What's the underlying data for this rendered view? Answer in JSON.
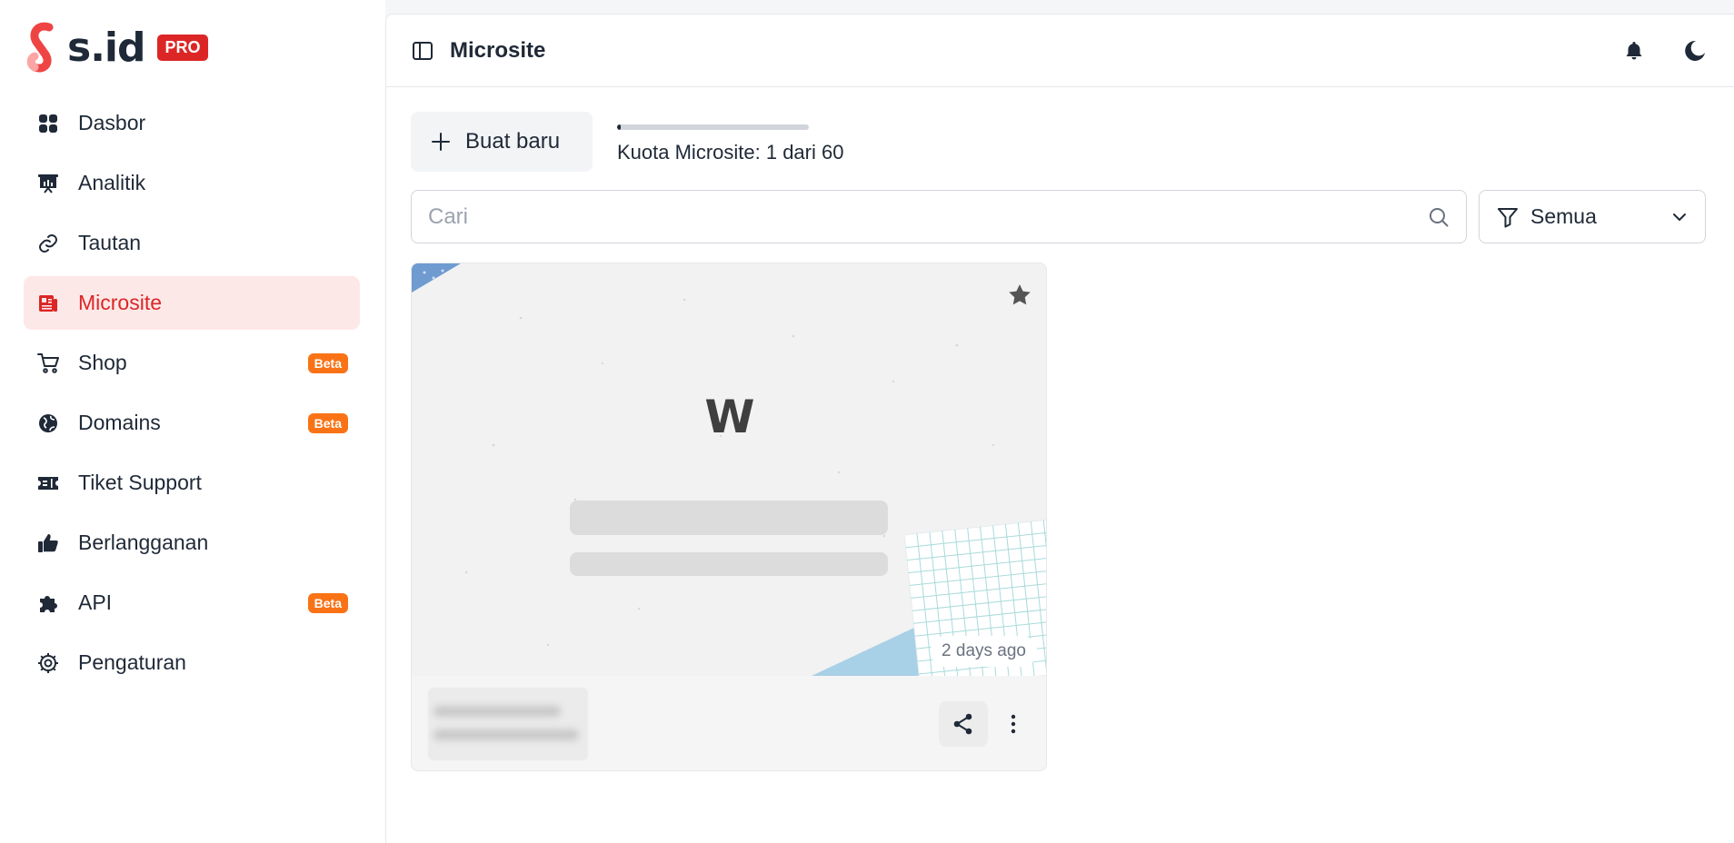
{
  "brand": {
    "name": "s.id",
    "badge": "PRO",
    "accent": "#dc2626"
  },
  "sidebar": {
    "items": [
      {
        "label": "Dasbor",
        "icon": "grid-icon",
        "active": false
      },
      {
        "label": "Analitik",
        "icon": "presentation-chart-icon",
        "active": false
      },
      {
        "label": "Tautan",
        "icon": "link-icon",
        "active": false
      },
      {
        "label": "Microsite",
        "icon": "newspaper-icon",
        "active": true
      },
      {
        "label": "Shop",
        "icon": "cart-icon",
        "active": false,
        "badge": "Beta"
      },
      {
        "label": "Domains",
        "icon": "globe-icon",
        "active": false,
        "badge": "Beta"
      },
      {
        "label": "Tiket Support",
        "icon": "ticket-icon",
        "active": false
      },
      {
        "label": "Berlangganan",
        "icon": "thumbs-up-icon",
        "active": false
      },
      {
        "label": "API",
        "icon": "puzzle-icon",
        "active": false,
        "badge": "Beta"
      },
      {
        "label": "Pengaturan",
        "icon": "gear-icon",
        "active": false
      }
    ]
  },
  "header": {
    "title": "Microsite"
  },
  "toolbar": {
    "new_label": "Buat baru",
    "quota_text": "Kuota Microsite: 1 dari 60",
    "quota_used": 1,
    "quota_total": 60
  },
  "search": {
    "placeholder": "Cari",
    "value": ""
  },
  "filter": {
    "selected": "Semua"
  },
  "cards": [
    {
      "thumb_letter": "W",
      "time": "2 days ago",
      "starred": true
    }
  ]
}
